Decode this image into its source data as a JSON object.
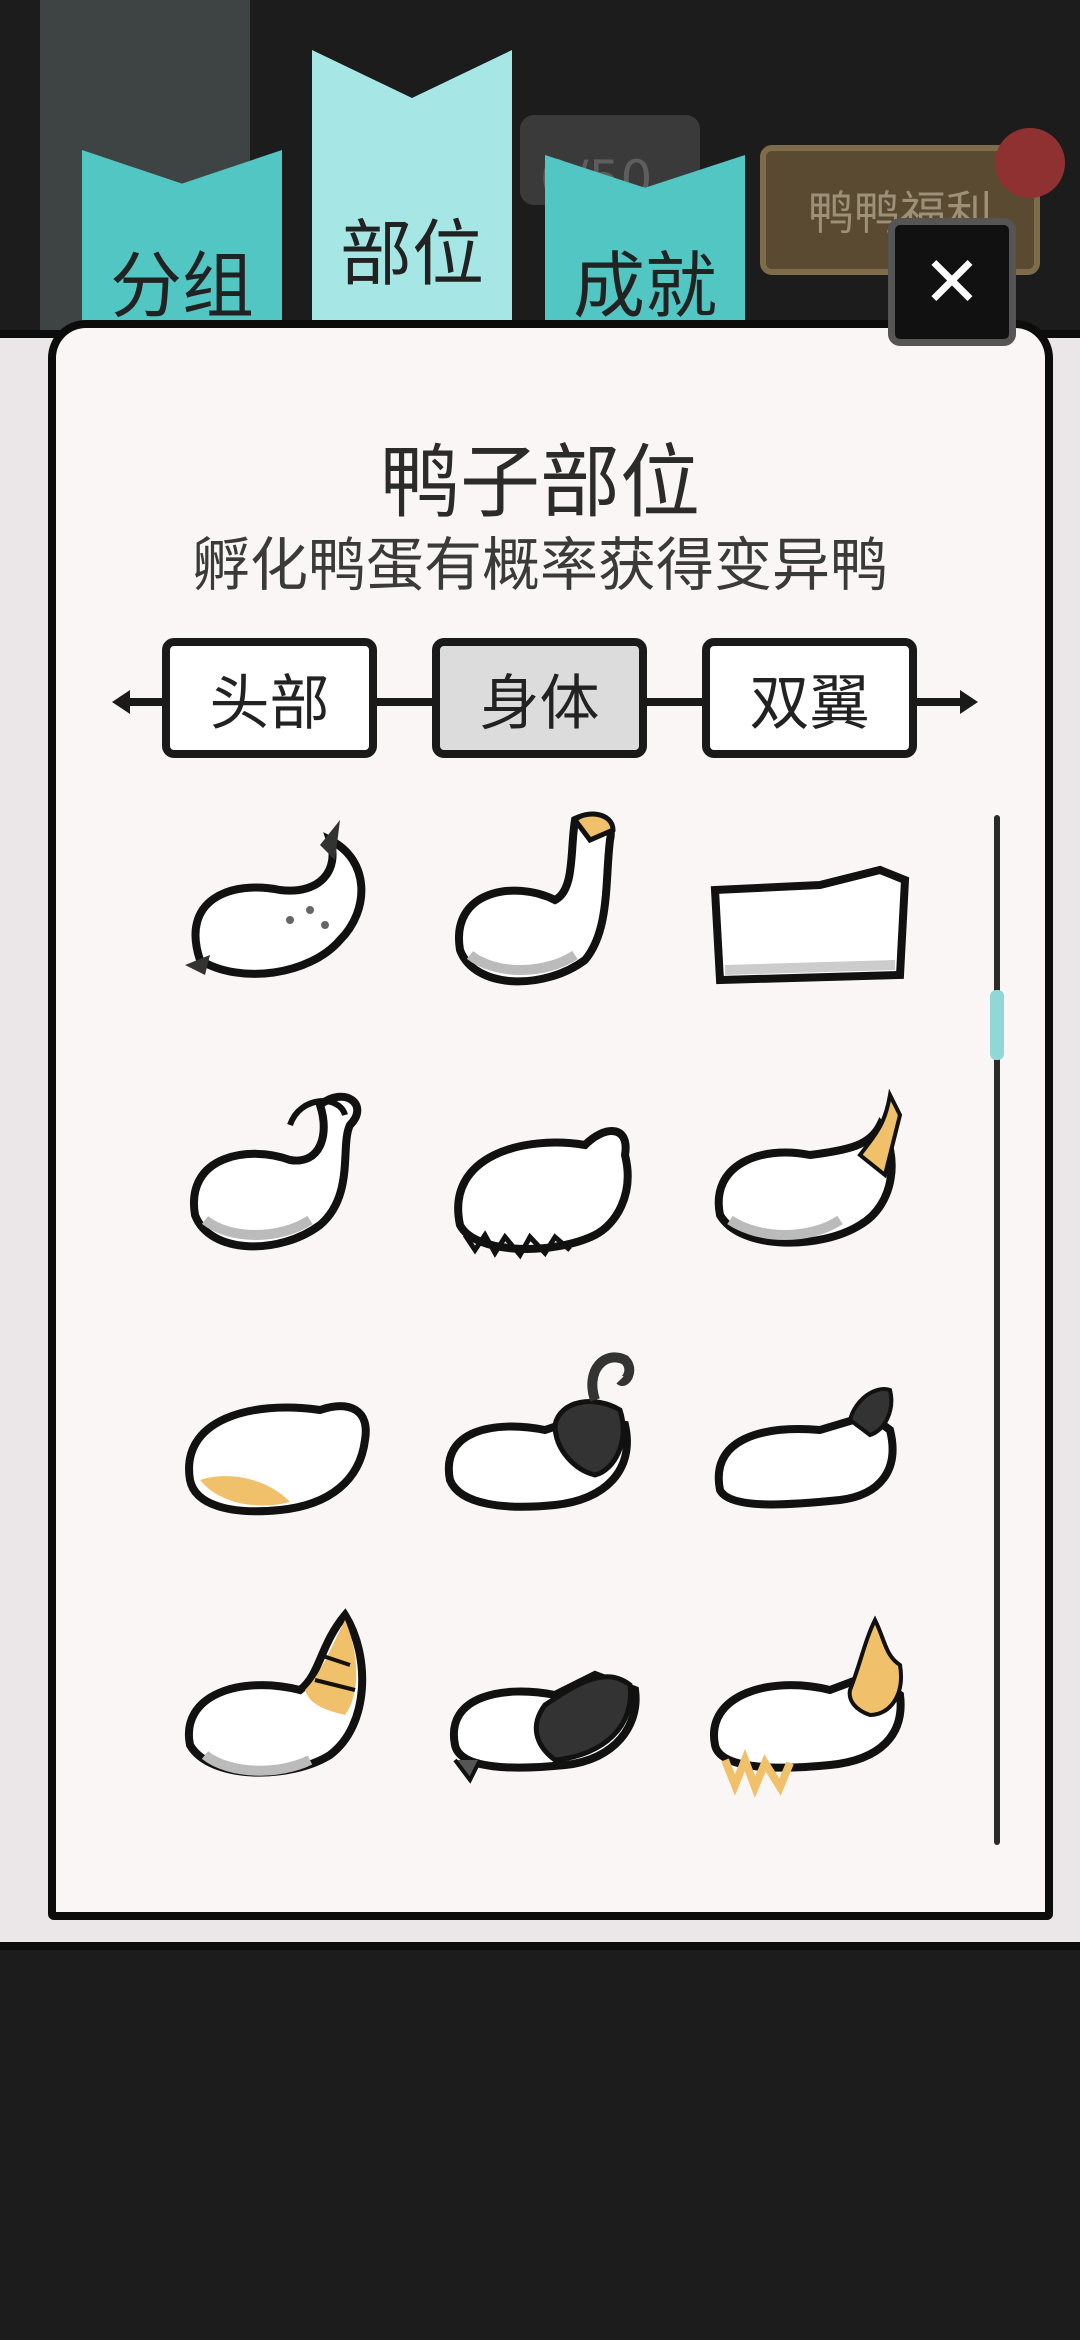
{
  "header": {
    "tabs": [
      {
        "label": "分组"
      },
      {
        "label": "部位"
      },
      {
        "label": "成就"
      }
    ],
    "welfare_label": "鸭鸭福利",
    "counter_text": "0/50",
    "close_symbol": "✕"
  },
  "book": {
    "title": "鸭子部位",
    "subtitle": "孵化鸭蛋有概率获得变异鸭",
    "categories": [
      {
        "label": "头部"
      },
      {
        "label": "身体"
      },
      {
        "label": "双翼"
      }
    ],
    "active_category": "身体"
  },
  "colors": {
    "tab_inactive": "#52c6c3",
    "tab_active": "#a6e7e5",
    "page_bg": "#faf6f6",
    "accent_orange": "#f0c06a"
  },
  "body_items": [
    {
      "name": "spotted-tail-body-icon"
    },
    {
      "name": "snake-neck-body-icon"
    },
    {
      "name": "box-body-icon"
    },
    {
      "name": "curly-tail-body-icon"
    },
    {
      "name": "shaggy-body-icon"
    },
    {
      "name": "orange-tuft-body-icon"
    },
    {
      "name": "orange-belly-body-icon"
    },
    {
      "name": "black-hook-body-icon"
    },
    {
      "name": "black-cap-body-icon"
    },
    {
      "name": "tiger-tail-body-icon"
    },
    {
      "name": "dark-wing-body-icon"
    },
    {
      "name": "fire-tail-body-icon"
    }
  ]
}
